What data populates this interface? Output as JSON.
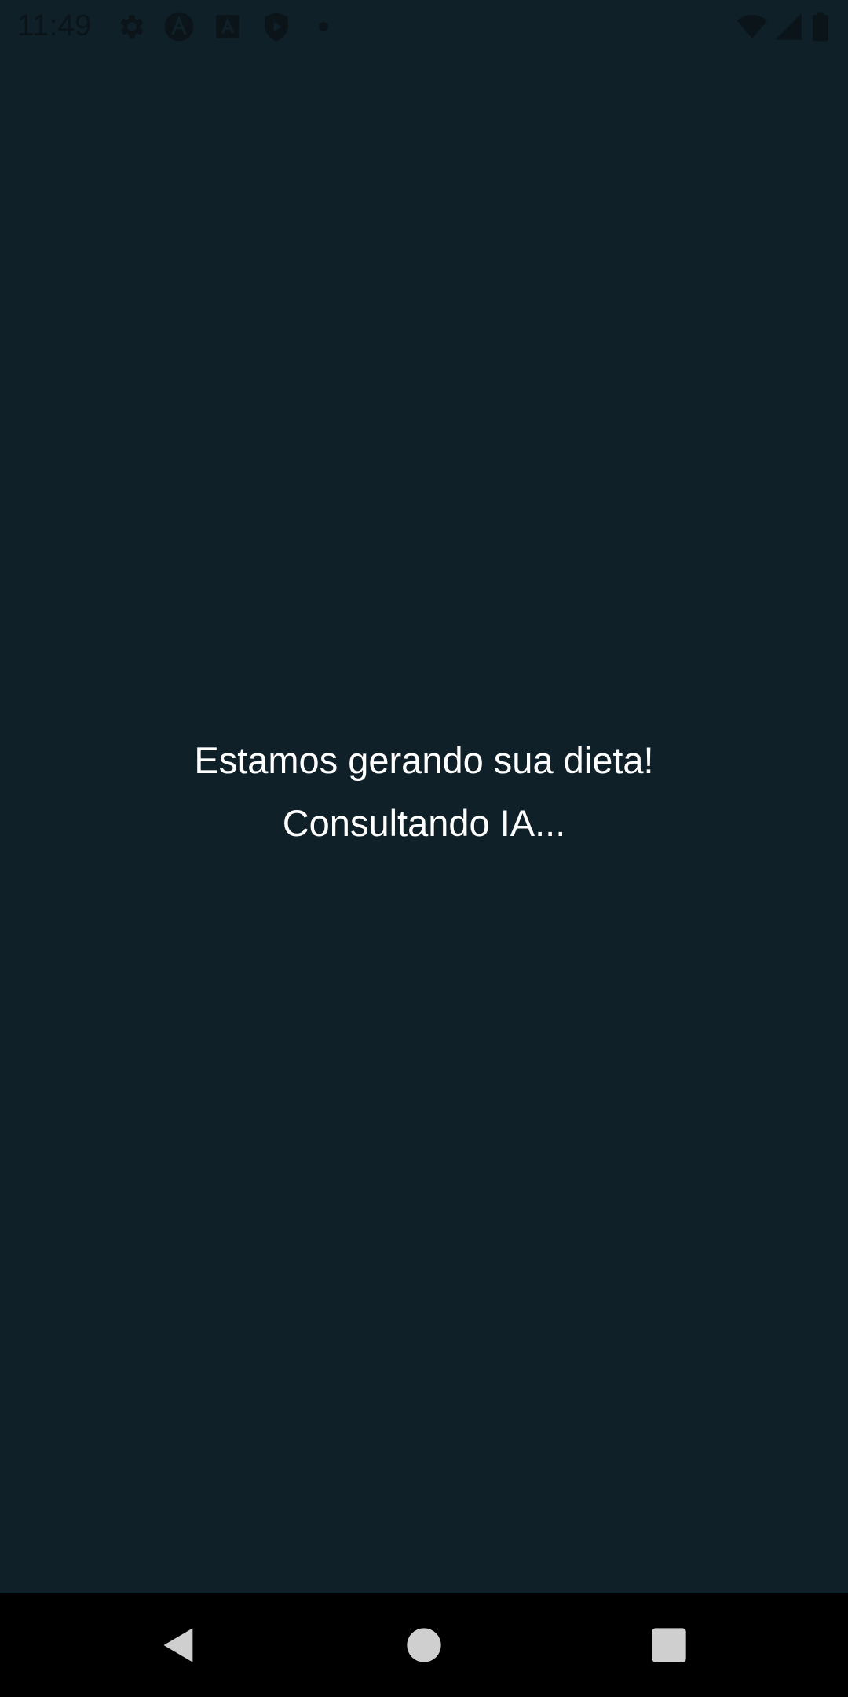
{
  "status_bar": {
    "time": "11:49",
    "left_icons": [
      "gear-icon",
      "app-a-icon",
      "app-a-square-icon",
      "shield-play-icon",
      "dot-icon"
    ],
    "right_icons": [
      "wifi-icon",
      "signal-icon",
      "battery-icon"
    ]
  },
  "loading": {
    "title": "Estamos gerando sua dieta!",
    "subtitle": "Consultando IA..."
  },
  "nav_bar": {
    "buttons": [
      "back-icon",
      "home-icon",
      "recents-icon"
    ]
  },
  "colors": {
    "background": "#0f2029",
    "text": "#ffffff",
    "nav_background": "#000000",
    "nav_icon": "#cfcfcf"
  }
}
